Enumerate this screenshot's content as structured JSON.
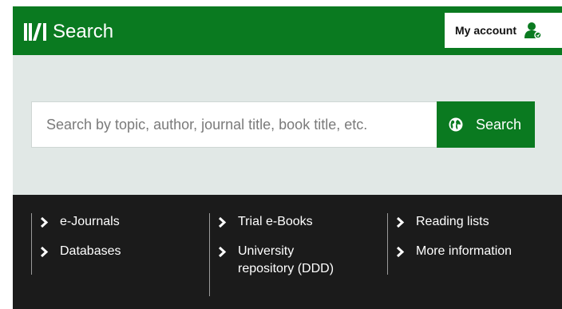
{
  "header": {
    "logo_text": "Search",
    "account_label": "My account"
  },
  "search": {
    "placeholder": "Search by topic, author, journal title, book title, etc.",
    "button_label": "Search"
  },
  "footer": {
    "columns": [
      {
        "links": [
          "e-Journals",
          "Databases"
        ]
      },
      {
        "links": [
          "Trial e-Books",
          "University repository (DDD)"
        ]
      },
      {
        "links": [
          "Reading lists",
          "More information"
        ]
      }
    ]
  },
  "colors": {
    "brand_green": "#0a7a20",
    "search_band": "#e1e8e6",
    "footer_bg": "#1b1b1b"
  },
  "icons": [
    "uvi-logo-icon",
    "user-icon",
    "globe-icon",
    "chevron-right-icon"
  ]
}
